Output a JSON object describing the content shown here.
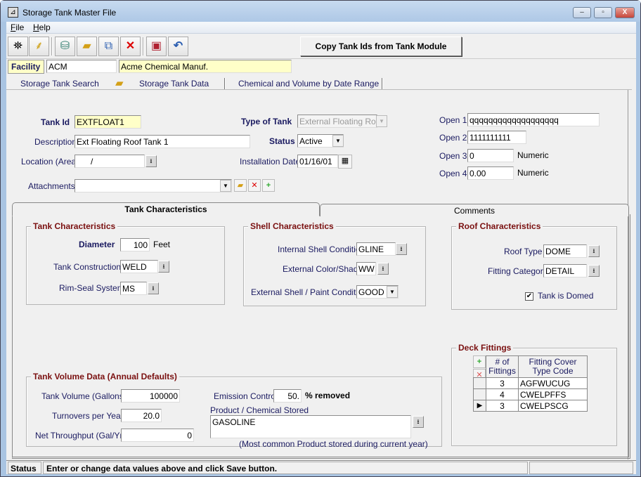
{
  "window": {
    "title": "Storage Tank Master File",
    "controls": {
      "minimize": "–",
      "maximize": "▫",
      "close": "X"
    }
  },
  "menu": {
    "items": [
      {
        "label": "File",
        "hotkey": "F"
      },
      {
        "label": "Help",
        "hotkey": "H"
      }
    ]
  },
  "toolbar": {
    "buttons": [
      {
        "name": "binoculars-icon",
        "glyph": "👓"
      },
      {
        "name": "broom-icon",
        "glyph": "🧹"
      },
      {
        "name": "database-add-icon",
        "glyph": "🗄"
      },
      {
        "name": "open-folder-icon",
        "glyph": "📂"
      },
      {
        "name": "copy-icon",
        "glyph": "⎘"
      },
      {
        "name": "delete-icon",
        "glyph": "✕"
      },
      {
        "name": "save-icon",
        "glyph": "💾"
      },
      {
        "name": "undo-icon",
        "glyph": "↶"
      }
    ],
    "copy_button": "Copy Tank Ids from Tank Module"
  },
  "facility": {
    "label": "Facility",
    "code": "ACM",
    "name": "Acme Chemical Manuf."
  },
  "top_tabs": [
    {
      "label": "Storage Tank Search"
    },
    {
      "label": "Storage Tank Data",
      "active": true
    },
    {
      "label": "Chemical and Volume by Date Range"
    }
  ],
  "form": {
    "tank_id": {
      "label": "Tank Id",
      "value": "EXTFLOAT1"
    },
    "description": {
      "label": "Description",
      "value": "Ext Floating Roof Tank 1"
    },
    "location": {
      "label": "Location (Area)",
      "value": "      /"
    },
    "attachments": {
      "label": "Attachments",
      "value": ""
    },
    "type_of_tank": {
      "label": "Type of Tank",
      "value": "External Floating Roof"
    },
    "status": {
      "label": "Status",
      "value": "Active"
    },
    "installation_date": {
      "label": "Installation Date",
      "value": "01/16/01"
    },
    "open1": {
      "label": "Open 1",
      "value": "qqqqqqqqqqqqqqqqqqq"
    },
    "open2": {
      "label": "Open 2",
      "value": "1111111111"
    },
    "open3": {
      "label": "Open 3",
      "value": "0",
      "suffix": "Numeric"
    },
    "open4": {
      "label": "Open 4",
      "value": "0.00",
      "suffix": "Numeric"
    }
  },
  "inner_tabs": [
    {
      "label": "Tank Characteristics",
      "active": true
    },
    {
      "label": "Comments"
    }
  ],
  "tank_char": {
    "title": "Tank Characteristics",
    "diameter": {
      "label": "Diameter",
      "value": "100",
      "unit": "Feet"
    },
    "construction": {
      "label": "Tank Construction",
      "value": "WELD"
    },
    "rim_seal": {
      "label": "Rim-Seal System",
      "value": "MS"
    }
  },
  "shell_char": {
    "title": "Shell Characteristics",
    "internal": {
      "label": "Internal Shell Condition",
      "value": "GLINE"
    },
    "color": {
      "label": "External Color/Shade",
      "value": "WW"
    },
    "paint": {
      "label": "External Shell / Paint Condition",
      "value": "GOOD"
    }
  },
  "roof_char": {
    "title": "Roof Characteristics",
    "roof_type": {
      "label": "Roof Type",
      "value": "DOME"
    },
    "fitting_category": {
      "label": "Fitting Category",
      "value": "DETAIL"
    },
    "domed": {
      "label": "Tank is Domed",
      "checked": true
    }
  },
  "volume": {
    "title": "Tank Volume Data (Annual Defaults)",
    "tank_volume": {
      "label": "Tank Volume (Gallons)",
      "value": "100000"
    },
    "turnovers": {
      "label": "Turnovers per Year",
      "value": "20.0"
    },
    "throughput": {
      "label": "Net Throughput (Gal/Yr)",
      "value": "0"
    },
    "emission": {
      "label": "Emission Control",
      "value": "50.",
      "suffix": "% removed"
    },
    "product": {
      "label": "Product / Chemical Stored",
      "value": "GASOLINE",
      "note": "(Most common Product stored during current year)"
    }
  },
  "deck": {
    "title": "Deck Fittings",
    "headers": [
      "# of Fittings",
      "Fitting Cover Type Code"
    ],
    "rows": [
      {
        "count": "3",
        "code": "AGFWUCUG",
        "current": false
      },
      {
        "count": "4",
        "code": "CWELPFFS",
        "current": false
      },
      {
        "count": "3",
        "code": "CWELPSCG",
        "current": true
      }
    ]
  },
  "statusbar": {
    "label": "Status",
    "message": "Enter or change data values above and click Save button."
  },
  "colors": {
    "highlight_yellow": "#ffffc8",
    "label_navy": "#1a1a60",
    "group_title": "#7a1010"
  }
}
